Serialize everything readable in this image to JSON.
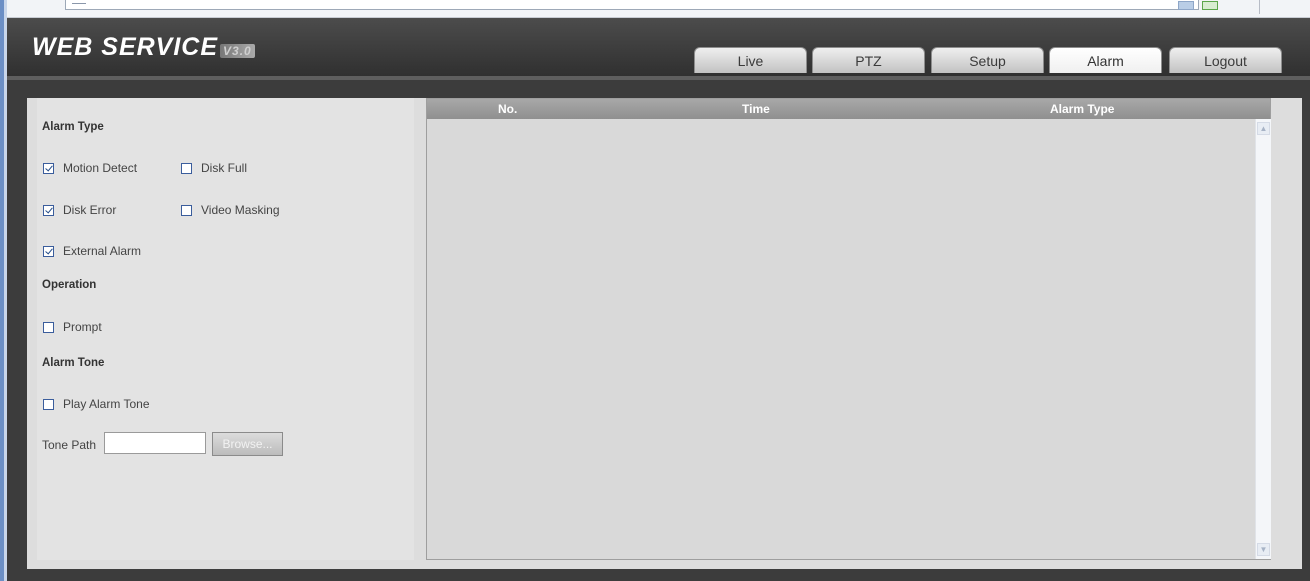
{
  "app": {
    "logo_text": "WEB  SERVICE",
    "logo_version": "V3.0"
  },
  "tabs": [
    {
      "label": "Live",
      "active": false
    },
    {
      "label": "PTZ",
      "active": false
    },
    {
      "label": "Setup",
      "active": false
    },
    {
      "label": "Alarm",
      "active": true
    },
    {
      "label": "Logout",
      "active": false
    }
  ],
  "alarm_type": {
    "heading": "Alarm Type",
    "motion_detect": {
      "label": "Motion Detect",
      "checked": true
    },
    "disk_full": {
      "label": "Disk Full",
      "checked": false
    },
    "disk_error": {
      "label": "Disk Error",
      "checked": true
    },
    "video_masking": {
      "label": "Video Masking",
      "checked": false
    },
    "external_alarm": {
      "label": "External Alarm",
      "checked": true
    }
  },
  "operation": {
    "heading": "Operation",
    "prompt": {
      "label": "Prompt",
      "checked": false
    }
  },
  "alarm_tone": {
    "heading": "Alarm Tone",
    "play_alarm_tone": {
      "label": "Play Alarm Tone",
      "checked": false
    },
    "tone_path_label": "Tone Path",
    "tone_path_value": "",
    "browse_label": "Browse..."
  },
  "table": {
    "columns": [
      "No.",
      "Time",
      "Alarm Type"
    ],
    "rows": []
  },
  "colors": {
    "header_bg": "#3c3c3c",
    "panel_bg": "#e3e3e3",
    "checkbox_border": "#3a5d9c"
  }
}
